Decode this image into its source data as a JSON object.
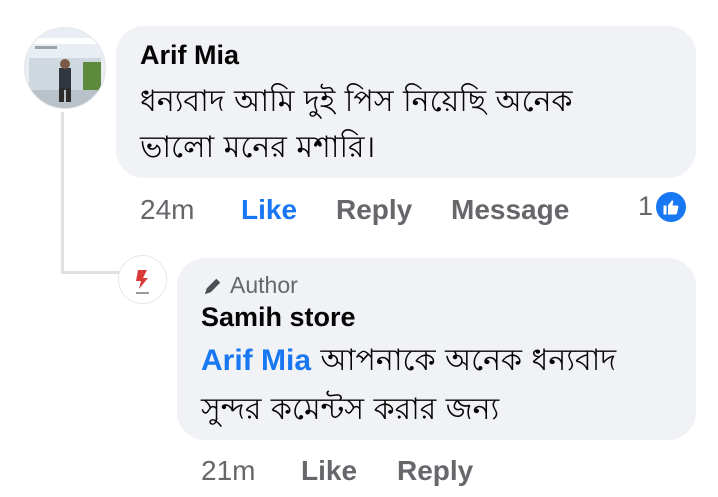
{
  "comment": {
    "author": "Arif Mia",
    "text_line1": "ধন্যবাদ আমি দুই পিস নিয়েছি অনেক",
    "text_line2": "ভালো মনের মশারি।",
    "time": "24m",
    "like_label": "Like",
    "reply_label": "Reply",
    "message_label": "Message",
    "reaction_count": "1",
    "reaction_icon": "thumbs-up-icon",
    "like_active_color": "#1877f2"
  },
  "reply": {
    "badge_label": "Author",
    "badge_icon": "pencil-icon",
    "author": "Samih store",
    "mention": "Arif Mia",
    "text_line1": " আপনাকে অনেক ধন্যবাদ",
    "text_line2": "সুন্দর কমেন্টস করার জন্য",
    "time": "21m",
    "like_label": "Like",
    "reply_label": "Reply"
  }
}
